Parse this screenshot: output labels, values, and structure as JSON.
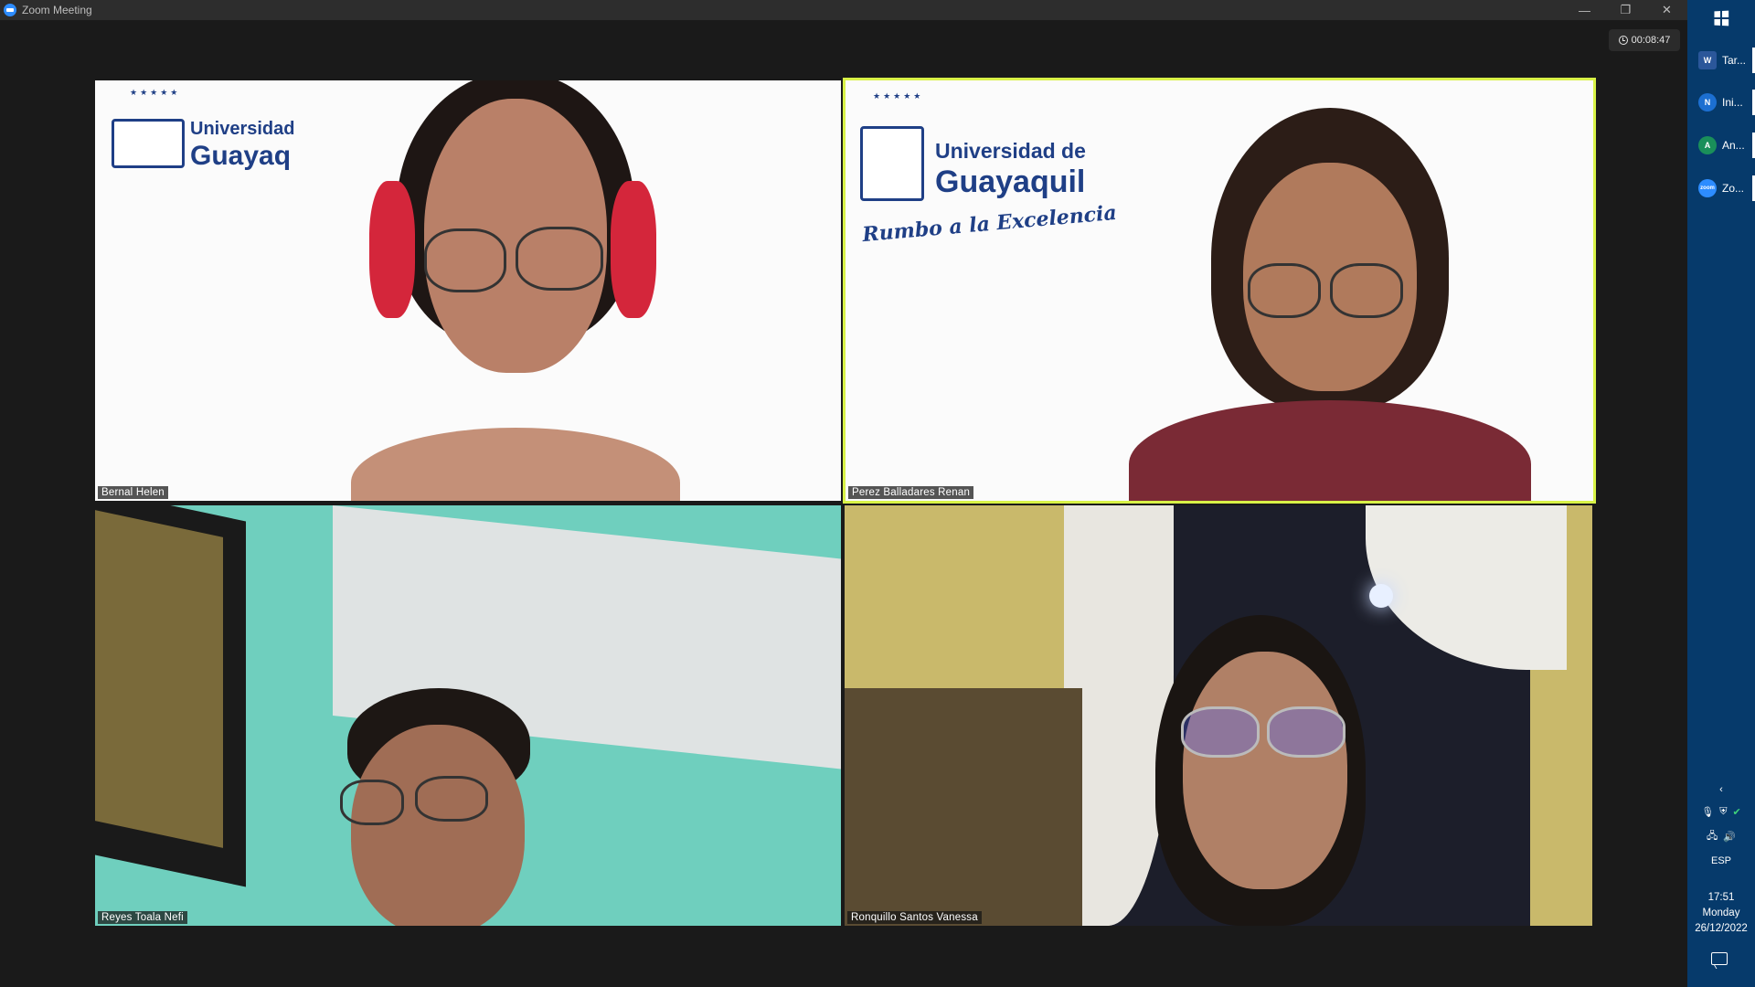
{
  "window": {
    "title": "Zoom Meeting",
    "controls": {
      "minimize": "—",
      "restore": "❐",
      "close": "✕"
    }
  },
  "meeting": {
    "timer": "00:08:47",
    "participants": [
      {
        "name": "Bernal Helen",
        "active_speaker": false
      },
      {
        "name": "Perez Balladares Renan",
        "active_speaker": true
      },
      {
        "name": "Reyes Toala Nefi",
        "active_speaker": false
      },
      {
        "name": "Ronquillo Santos Vanessa",
        "active_speaker": false
      }
    ]
  },
  "backgrounds": {
    "logo_line1": "Universidad",
    "logo_line1_full": "Universidad de",
    "logo_line2_partial": "Guayaq",
    "logo_line2": "Guayaquil",
    "slogan": "Rumbo a la Excelencia"
  },
  "taskbar": {
    "items": [
      {
        "label": "Tar...",
        "icon": "word-icon",
        "icon_text": "W",
        "color": "#2b579a"
      },
      {
        "label": "Ini...",
        "icon": "app-icon",
        "icon_text": "N",
        "color": "#1c6fd1"
      },
      {
        "label": "An...",
        "icon": "app-icon",
        "icon_text": "A",
        "color": "#1a8f5a"
      },
      {
        "label": "Zo...",
        "icon": "zoom-icon",
        "icon_text": "zoom",
        "color": "#2d8cff"
      }
    ],
    "language": "ESP",
    "time": "17:51",
    "day": "Monday",
    "date": "26/12/2022"
  }
}
